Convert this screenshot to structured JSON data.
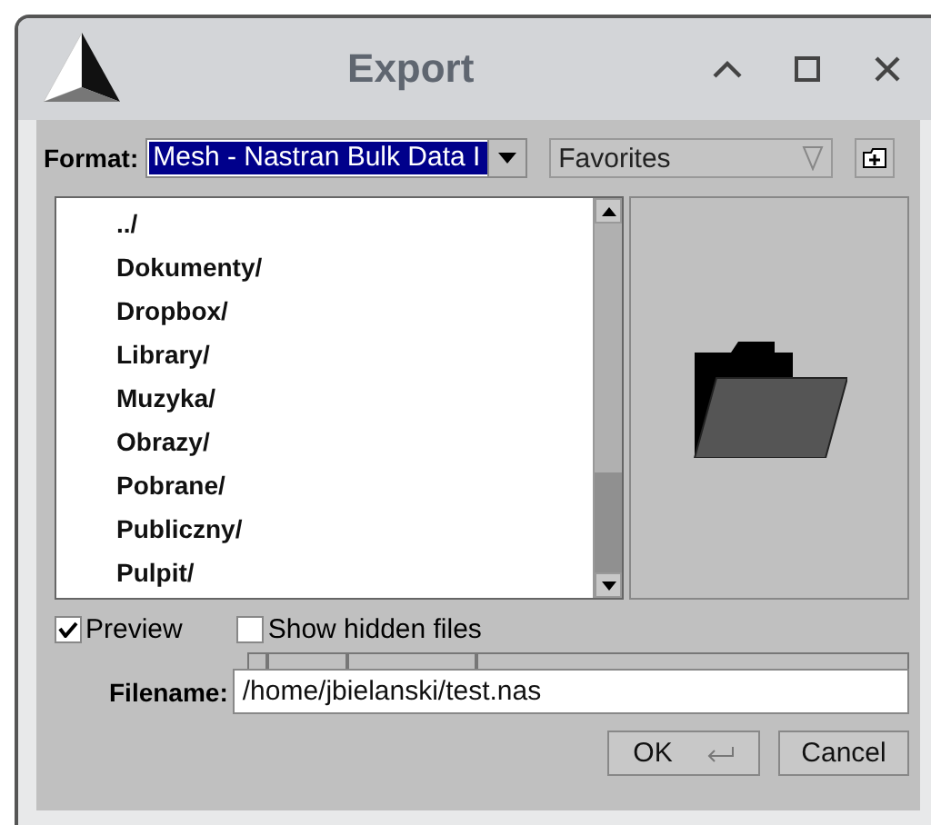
{
  "window": {
    "title": "Export"
  },
  "format": {
    "label": "Format:",
    "value": "Mesh - Nastran Bulk Data I"
  },
  "favorites": {
    "value": "Favorites"
  },
  "files": [
    {
      "name": "../"
    },
    {
      "name": "Dokumenty/"
    },
    {
      "name": "Dropbox/"
    },
    {
      "name": "Library/"
    },
    {
      "name": "Muzyka/"
    },
    {
      "name": "Obrazy/"
    },
    {
      "name": "Pobrane/"
    },
    {
      "name": "Publiczny/"
    },
    {
      "name": "Pulpit/"
    }
  ],
  "options": [
    {
      "label": "Preview",
      "checked": true
    },
    {
      "label": "Show hidden files",
      "checked": false
    }
  ],
  "filename": {
    "label": "Filename:",
    "value": "/home/jbielanski/test.nas"
  },
  "buttons": [
    {
      "label": "OK",
      "kind": "default"
    },
    {
      "label": "Cancel",
      "kind": "plain"
    }
  ]
}
